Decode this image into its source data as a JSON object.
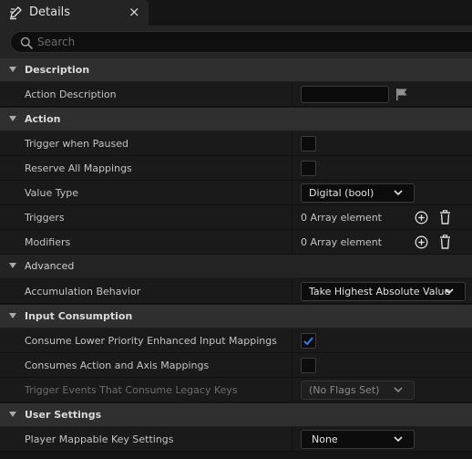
{
  "tab": {
    "title": "Details",
    "close_glyph": "×",
    "icon": "pencil-icon"
  },
  "search": {
    "placeholder": "Search",
    "value": ""
  },
  "colors": {
    "accent": "#2f7fe0",
    "category_bg": "#2f2f2f",
    "row_bg": "#1a1a1a"
  },
  "sections": {
    "description": {
      "label": "Description",
      "action_description": {
        "label": "Action Description",
        "value": ""
      }
    },
    "action": {
      "label": "Action",
      "trigger_when_paused": {
        "label": "Trigger when Paused",
        "checked": false
      },
      "reserve_all_mappings": {
        "label": "Reserve All Mappings",
        "checked": false
      },
      "value_type": {
        "label": "Value Type",
        "selected": "Digital (bool)"
      },
      "triggers": {
        "label": "Triggers",
        "value": "0 Array element"
      },
      "modifiers": {
        "label": "Modifiers",
        "value": "0 Array element"
      }
    },
    "advanced": {
      "label": "Advanced",
      "accumulation_behavior": {
        "label": "Accumulation Behavior",
        "selected": "Take Highest Absolute Value"
      }
    },
    "input_consumption": {
      "label": "Input Consumption",
      "consume_lower_priority": {
        "label": "Consume Lower Priority Enhanced Input Mappings",
        "checked": true
      },
      "consumes_action_axis": {
        "label": "Consumes Action and Axis Mappings",
        "checked": false
      },
      "trigger_events_legacy": {
        "label": "Trigger Events That Consume Legacy Keys",
        "selected": "(No Flags Set)",
        "enabled": false
      }
    },
    "user_settings": {
      "label": "User Settings",
      "player_mappable": {
        "label": "Player Mappable Key Settings",
        "selected": "None"
      }
    }
  }
}
